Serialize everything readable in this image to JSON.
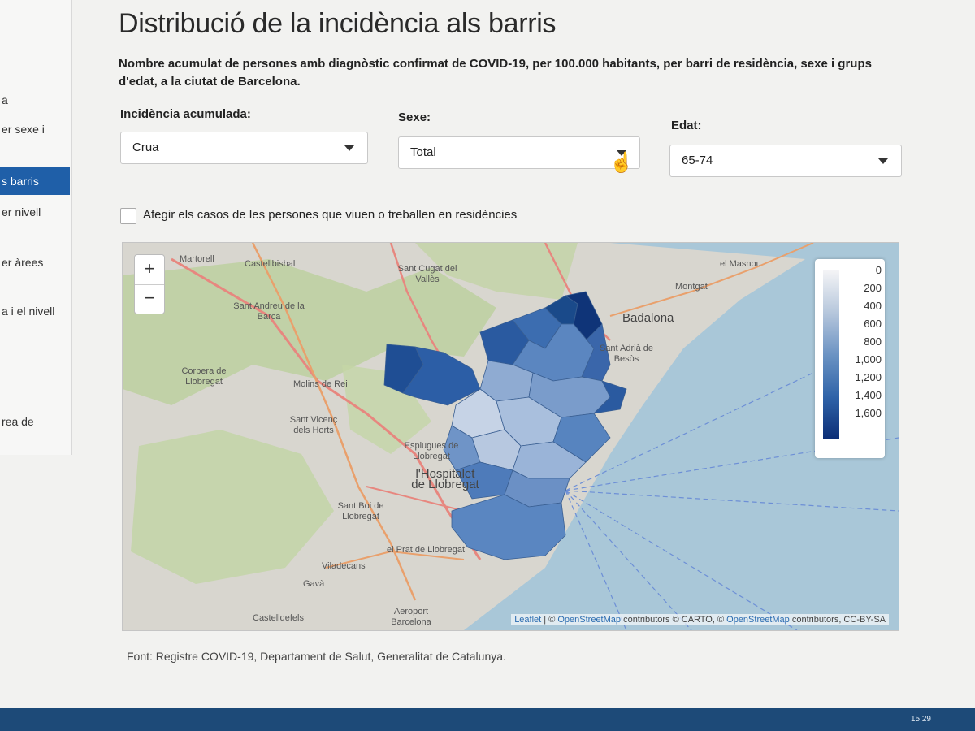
{
  "sidebar": {
    "items": [
      {
        "label": "a"
      },
      {
        "label": "er sexe i"
      },
      {
        "label": "s barris"
      },
      {
        "label": "er nivell"
      },
      {
        "label": "er àrees"
      },
      {
        "label": "a i el nivell"
      },
      {
        "label": "rea de"
      }
    ]
  },
  "page": {
    "title": "Distribució de la incidència als barris",
    "subtitle": "Nombre acumulat de persones amb diagnòstic confirmat de COVID-19, per 100.000 habitants, per barri de residència, sexe i grups d'edat, a la ciutat de Barcelona."
  },
  "filters": {
    "incidencia": {
      "label": "Incidència acumulada:",
      "value": "Crua"
    },
    "sexe": {
      "label": "Sexe:",
      "value": "Total"
    },
    "edat": {
      "label": "Edat:",
      "value": "65-74"
    }
  },
  "checkbox": {
    "label": "Afegir els casos de les persones que viuen o treballen en residències",
    "checked": false
  },
  "map": {
    "zoom_in": "+",
    "zoom_out": "−",
    "legend": {
      "ticks": [
        "0",
        "200",
        "400",
        "600",
        "800",
        "1,000",
        "1,200",
        "1,400",
        "1,600"
      ]
    },
    "place_labels": {
      "martorell": "Martorell",
      "castellbisbal": "Castellbisbal",
      "sant_cugat": "Sant Cugat del Vallès",
      "montgat": "Montgat",
      "el_masnou": "el Masnou",
      "sant_andreu_barca": "Sant Andreu de la Barca",
      "badalona": "Badalona",
      "corbera": "Corbera de Llobregat",
      "molins": "Molins de Rei",
      "sant_adria": "Sant Adrià de Besòs",
      "sant_vicenc": "Sant Vicenç dels Horts",
      "esplugues": "Esplugues de Llobregat",
      "hospitalet": "l'Hospitalet de Llobregat",
      "sant_boi": "Sant Boi de Llobregat",
      "el_prat": "el Prat de Llobregat",
      "viladecans": "Viladecans",
      "gava": "Gavà",
      "castelldefels": "Castelldefels",
      "aeroport": "Aeroport Barcelona"
    },
    "attribution": {
      "leaflet": "Leaflet",
      "sep": " | © ",
      "osm1": "OpenStreetMap",
      "mid": " contributors © CARTO, © ",
      "osm2": "OpenStreetMap",
      "end": " contributors, CC-BY-SA"
    }
  },
  "source": "Font: Registre COVID-19, Departament de Salut, Generalitat de Catalunya.",
  "taskbar": {
    "time": "15:29"
  },
  "colors": {
    "active_sidebar": "#1f5fa8",
    "scale_low": "#f4f4f6",
    "scale_high": "#0b2d76",
    "sea": "#a9c7d8",
    "land": "#d8d6cf",
    "park": "#b9cf98"
  }
}
